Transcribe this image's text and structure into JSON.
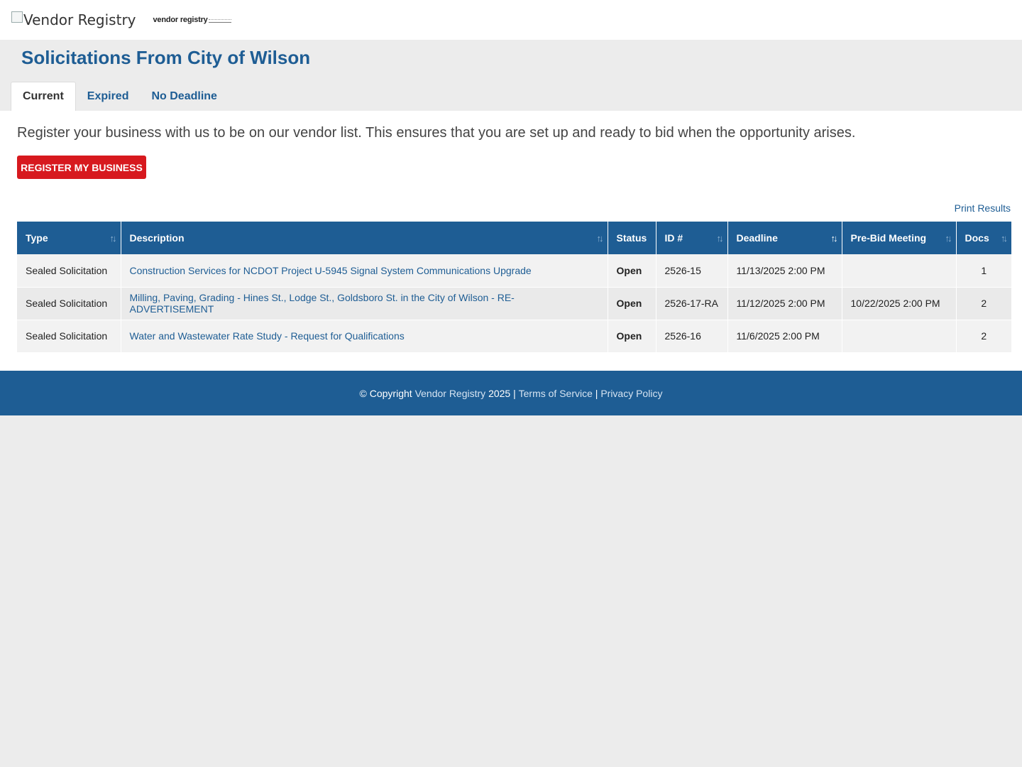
{
  "header": {
    "logo_alt": "Vendor Registry",
    "logo_mark": "vendor registry"
  },
  "page": {
    "title": "Solicitations From City of Wilson"
  },
  "tabs": [
    {
      "label": "Current",
      "active": true
    },
    {
      "label": "Expired",
      "active": false
    },
    {
      "label": "No Deadline",
      "active": false
    }
  ],
  "intro": {
    "text": "Register your business with us to be on our vendor list. This ensures that you are set up and ready to bid when the opportunity arises.",
    "register_label": "REGISTER MY BUSINESS"
  },
  "print_label": "Print Results",
  "table": {
    "columns": [
      "Type",
      "Description",
      "Status",
      "ID #",
      "Deadline",
      "Pre-Bid Meeting",
      "Docs"
    ],
    "sort_icon": "↑↓",
    "rows": [
      {
        "type": "Sealed Solicitation",
        "description": "Construction Services for NCDOT Project U-5945 Signal System Communications Upgrade",
        "status": "Open",
        "id": "2526-15",
        "deadline": "11/13/2025 2:00 PM",
        "prebid": "",
        "docs": "1"
      },
      {
        "type": "Sealed Solicitation",
        "description": "Milling, Paving, Grading - Hines St., Lodge St., Goldsboro St. in the City of Wilson - RE-ADVERTISEMENT",
        "status": "Open",
        "id": "2526-17-RA",
        "deadline": "11/12/2025 2:00 PM",
        "prebid": "10/22/2025 2:00 PM",
        "docs": "2"
      },
      {
        "type": "Sealed Solicitation",
        "description": "Water and Wastewater Rate Study - Request for Qualifications",
        "status": "Open",
        "id": "2526-16",
        "deadline": "11/6/2025 2:00 PM",
        "prebid": "",
        "docs": "2"
      }
    ]
  },
  "footer": {
    "copyright": "© Copyright",
    "vendor_link": "Vendor Registry",
    "year": "2025",
    "sep": "|",
    "terms": "Terms of Service",
    "privacy": "Privacy Policy"
  },
  "colors": {
    "brand_blue": "#1e5d94",
    "register_red": "#d7191e",
    "page_bg": "#ececec"
  }
}
